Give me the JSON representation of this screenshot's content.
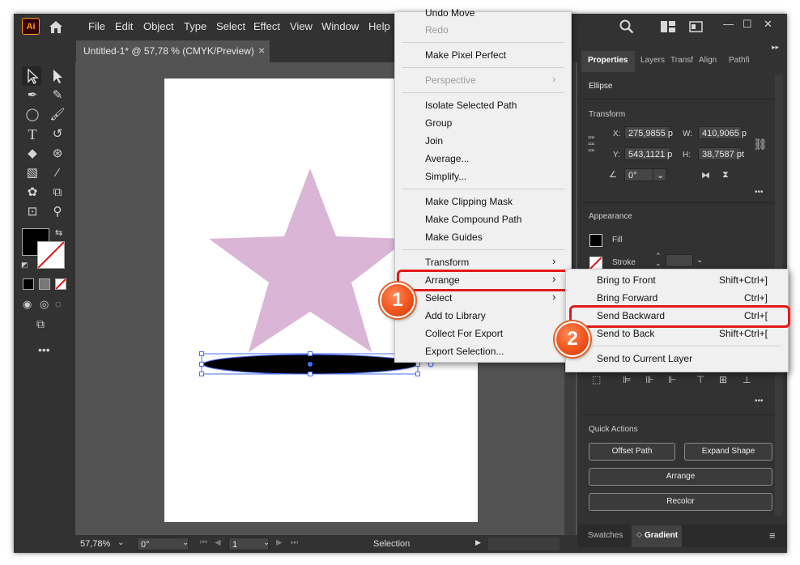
{
  "app": {
    "logo": "Ai",
    "home_icon": "home-icon"
  },
  "menu": [
    "File",
    "Edit",
    "Object",
    "Type",
    "Select",
    "Effect",
    "View",
    "Window",
    "Help"
  ],
  "header_icons": [
    "search-icon",
    "arrange-docs-icon",
    "workspace-icon"
  ],
  "window_controls": [
    "—",
    "☐",
    "✕"
  ],
  "document": {
    "tab_title": "Untitled-1* @ 57,78 % (CMYK/Preview)",
    "tab_close": "×"
  },
  "status": {
    "zoom": "57,78%",
    "rotation": "0°",
    "artboard": "1",
    "tool": "Selection"
  },
  "panel": {
    "tabs": [
      "Properties",
      "Layers",
      "Transf",
      "Align",
      "Pathfi"
    ],
    "selection": "Ellipse",
    "transform": {
      "title": "Transform",
      "x_label": "X:",
      "x": "275,9855 p",
      "y_label": "Y:",
      "y": "543,1121 p",
      "w_label": "W:",
      "w": "410,9065 p",
      "h_label": "H:",
      "h": "38,7587 pt",
      "angle": "0°"
    },
    "appearance": {
      "title": "Appearance",
      "fill": "Fill",
      "stroke": "Stroke"
    },
    "quick_actions": {
      "title": "Quick Actions",
      "offset_path": "Offset Path",
      "expand_shape": "Expand Shape",
      "arrange": "Arrange",
      "recolor": "Recolor"
    },
    "bottom_tabs": [
      "Swatches",
      "Gradient"
    ]
  },
  "context_menu": {
    "items": [
      {
        "label": "Undo Move",
        "disabled": false
      },
      {
        "label": "Redo",
        "disabled": true
      },
      {
        "label": "Make Pixel Perfect",
        "disabled": false
      },
      {
        "label": "Perspective",
        "disabled": true
      },
      {
        "label": "Isolate Selected Path",
        "disabled": false
      },
      {
        "label": "Group",
        "disabled": false
      },
      {
        "label": "Join",
        "disabled": false
      },
      {
        "label": "Average...",
        "disabled": false
      },
      {
        "label": "Simplify...",
        "disabled": false
      },
      {
        "label": "Make Clipping Mask",
        "disabled": false
      },
      {
        "label": "Make Compound Path",
        "disabled": false
      },
      {
        "label": "Make Guides",
        "disabled": false
      },
      {
        "label": "Transform",
        "disabled": false
      },
      {
        "label": "Arrange",
        "disabled": false
      },
      {
        "label": "Select",
        "disabled": false
      },
      {
        "label": "Add to Library",
        "disabled": false
      },
      {
        "label": "Collect For Export",
        "disabled": false
      },
      {
        "label": "Export Selection...",
        "disabled": false
      }
    ]
  },
  "arrange_submenu": {
    "items": [
      {
        "label": "Bring to Front",
        "shortcut": "Shift+Ctrl+]"
      },
      {
        "label": "Bring Forward",
        "shortcut": "Ctrl+]"
      },
      {
        "label": "Send Backward",
        "shortcut": "Ctrl+["
      },
      {
        "label": "Send to Back",
        "shortcut": "Shift+Ctrl+["
      },
      {
        "label": "Send to Current Layer",
        "shortcut": ""
      }
    ]
  },
  "annotations": {
    "step1": "1",
    "step2": "2"
  },
  "colors": {
    "star_fill": "#dab5d5",
    "ellipse_fill": "#000000",
    "highlight": "#e21a1a",
    "selection": "#4a6cf7",
    "badge": "#f0541c"
  }
}
